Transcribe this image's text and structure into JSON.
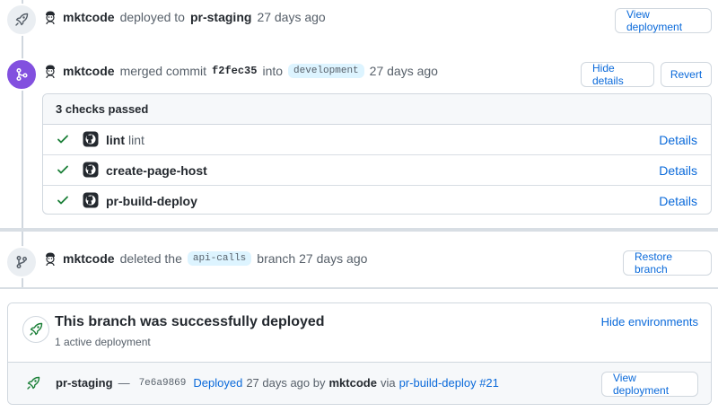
{
  "events": [
    {
      "author": "mktcode",
      "action": "deployed to",
      "target": "pr-staging",
      "time": "27 days ago",
      "button": "View deployment",
      "icon": "rocket-icon"
    },
    {
      "author": "mktcode",
      "action": "merged commit",
      "sha": "f2fec35",
      "into": "into",
      "branch": "development",
      "time": "27 days ago",
      "buttons": [
        "Hide details",
        "Revert"
      ],
      "icon": "git-merge-icon"
    },
    {
      "author": "mktcode",
      "action": "deleted the",
      "branch": "api-calls",
      "suffix": "branch",
      "time": "27 days ago",
      "button": "Restore branch",
      "icon": "git-branch-icon"
    }
  ],
  "checks": {
    "header": "3 checks passed",
    "items": [
      {
        "name": "lint",
        "desc": "lint",
        "link": "Details"
      },
      {
        "name": "create-page-host",
        "desc": "",
        "link": "Details"
      },
      {
        "name": "pr-build-deploy",
        "desc": "",
        "link": "Details"
      }
    ]
  },
  "deployment": {
    "title": "This branch was successfully deployed",
    "subtitle": "1 active deployment",
    "hide_label": "Hide environments",
    "row": {
      "env": "pr-staging",
      "dash": "—",
      "sha": "7e6a9869",
      "status": "Deployed",
      "time": "27 days ago by",
      "author": "mktcode",
      "via": "via",
      "workflow": "pr-build-deploy #21",
      "button": "View deployment"
    }
  },
  "colors": {
    "link": "#0969da",
    "success": "#1a7f37",
    "merged": "#8250df",
    "border": "#d0d7de"
  }
}
